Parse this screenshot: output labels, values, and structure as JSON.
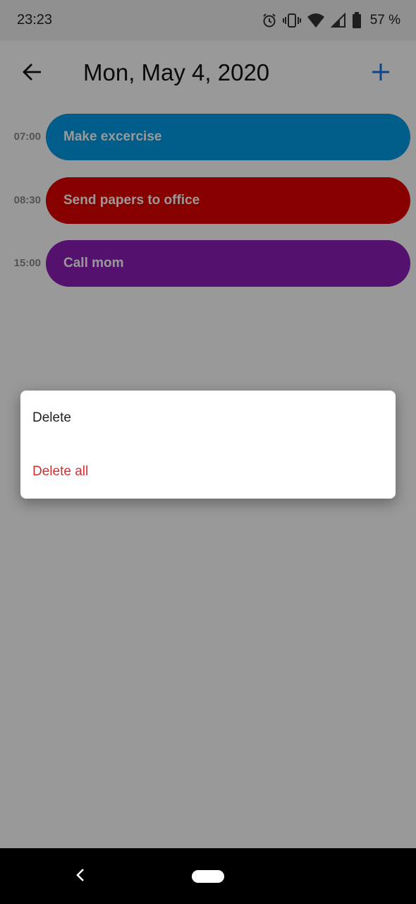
{
  "status_bar": {
    "time": "23:23",
    "battery_percent": "57 %",
    "icons": [
      "alarm-icon",
      "vibrate-icon",
      "wifi-icon",
      "signal-icon",
      "battery-icon"
    ]
  },
  "header": {
    "title": "Mon, May 4, 2020",
    "back_icon": "arrow-left-icon",
    "add_icon": "plus-icon",
    "accent_color": "#1a73e8"
  },
  "events": [
    {
      "time": "07:00",
      "title": "Make excercise",
      "color": "#0099e5"
    },
    {
      "time": "08:30",
      "title": "Send papers to office",
      "color": "#e00000"
    },
    {
      "time": "15:00",
      "title": "Call mom",
      "color": "#8c1fb7"
    }
  ],
  "dialog": {
    "items": [
      {
        "label": "Delete",
        "color": "#222222"
      },
      {
        "label": "Delete all",
        "color": "#d32f2f"
      }
    ]
  },
  "nav_bar": {
    "back_icon": "chevron-left-icon",
    "home_icon": "home-pill-icon"
  }
}
